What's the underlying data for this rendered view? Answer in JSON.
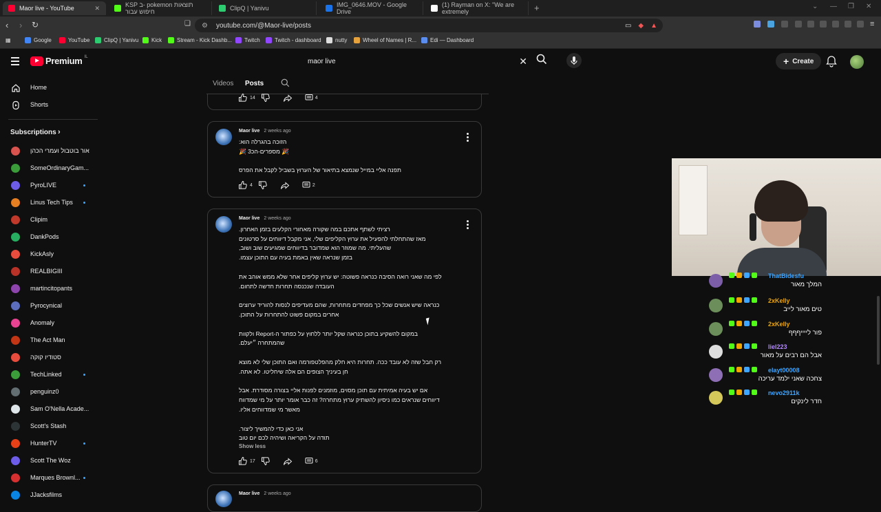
{
  "browser": {
    "tabs": [
      {
        "title": "Maor live - YouTube",
        "color": "#ff0033"
      },
      {
        "title": "KSP ב- pokemon תוצאות חיפוש עבור",
        "color": "#53fc18"
      },
      {
        "title": "ClipQ | Yanivu",
        "color": "#2ecc71"
      },
      {
        "title": "IMG_0646.MOV - Google Drive",
        "color": "#1a73e8"
      },
      {
        "title": "(1) Rayman on X: \"We are extremely",
        "color": "#ffffff"
      }
    ],
    "url": "youtube.com/@Maor-live/posts",
    "bookmarks": [
      {
        "label": "Google",
        "color": "#4285f4"
      },
      {
        "label": "YouTube",
        "color": "#ff0033"
      },
      {
        "label": "ClipQ | Yanivu",
        "color": "#2ecc71"
      },
      {
        "label": "Kick",
        "color": "#53fc18"
      },
      {
        "label": "Stream - Kick Dashb...",
        "color": "#53fc18"
      },
      {
        "label": "Twitch",
        "color": "#9146ff"
      },
      {
        "label": "Twitch - dashboard",
        "color": "#9146ff"
      },
      {
        "label": "nutty",
        "color": "#dddddd"
      },
      {
        "label": "Wheel of Names | R...",
        "color": "#e6a23c"
      },
      {
        "label": "Edi — Dashboard",
        "color": "#5b8def"
      }
    ]
  },
  "youtube": {
    "logo_text": "Premium",
    "country": "IL",
    "search_value": "maor live",
    "create_label": "Create",
    "sidebar": {
      "main": [
        {
          "label": "Home",
          "icon": "home-icon"
        },
        {
          "label": "Shorts",
          "icon": "shorts-icon"
        }
      ],
      "subscriptions_label": "Subscriptions",
      "channels": [
        {
          "label": "אור בוטבול ועמרי הכהן",
          "color": "#d9534f",
          "dot": false
        },
        {
          "label": "SomeOrdinaryGam...",
          "color": "#3a9d3a",
          "dot": false
        },
        {
          "label": "PyroLIVE",
          "color": "#6c5ce7",
          "dot": true
        },
        {
          "label": "Linus Tech Tips",
          "color": "#e67e22",
          "dot": true
        },
        {
          "label": "Clipim",
          "color": "#c0392b",
          "dot": false
        },
        {
          "label": "DankPods",
          "color": "#27ae60",
          "dot": false
        },
        {
          "label": "KickAsly",
          "color": "#e74c3c",
          "dot": false
        },
        {
          "label": "REALBIGIII",
          "color": "#b83227",
          "dot": false
        },
        {
          "label": "martincitopants",
          "color": "#8e44ad",
          "dot": false
        },
        {
          "label": "Pyrocynical",
          "color": "#5d6dbe",
          "dot": false
        },
        {
          "label": "Anomaly",
          "color": "#e84393",
          "dot": false
        },
        {
          "label": "The Act Man",
          "color": "#c23616",
          "dot": false
        },
        {
          "label": "סטודיו קוקה",
          "color": "#e74c3c",
          "dot": false
        },
        {
          "label": "TechLinked",
          "color": "#3a9d3a",
          "dot": true
        },
        {
          "label": "penguinz0",
          "color": "#636e72",
          "dot": false
        },
        {
          "label": "Sam O'Nella Acade...",
          "color": "#dfe6e9",
          "dot": false
        },
        {
          "label": "Scott's Stash",
          "color": "#2d3436",
          "dot": false
        },
        {
          "label": "HunterTV",
          "color": "#e84118",
          "dot": true
        },
        {
          "label": "Scott The Woz",
          "color": "#6c5ce7",
          "dot": false
        },
        {
          "label": "Marques Brownl...",
          "color": "#d63031",
          "dot": true
        },
        {
          "label": "JJacksfilms",
          "color": "#0984e3",
          "dot": false
        }
      ]
    },
    "channel_tabs": [
      "Videos",
      "Posts"
    ],
    "posts": [
      {
        "likes": "14",
        "comments": "4"
      },
      {
        "author": "Maor live",
        "time": "2 weeks ago",
        "lines": [
          "הזוכה בהגרלה הוא:",
          "🎉 מספרים-הכ3 🎉",
          "",
          "תפנה אליי במייל שנמצא בתיאור של הערוץ בשביל לקבל את הפרס"
        ],
        "likes": "4",
        "comments": "2"
      },
      {
        "author": "Maor live",
        "time": "2 weeks ago",
        "lines": [
          "רציתי לשתף אתכם במה שקורה מאחורי הקלעים בזמן האחרון.",
          "מאז שהתחלתי להפעיל את ערוץ הקליפים שלי, אני מקבל דיווחים על סרטונים",
          "שהעליתי. מה שמוזר הוא שמדובר בדיווחים שמגיעים שוב ושוב,",
          "בזמן שנראה שאין באמת בעיה עם התוכן עצמו.",
          "",
          "לפי מה שאני רואה הסיבה כנראה פשוטה: יש ערוץ קליפים אחר שלא ממש אוהב את",
          "העובדה שנכנסה תחרות חדשה לתחום.",
          "",
          "כנראה שיש אנשים שכל כך מפחדים מתחרות, שהם מעדיפים לנסות להוריד ערוצים",
          "אחרים במקום פשוט להתחרות על התוכן.",
          "",
          "במקום להשקיע בתוכן כנראה שקל יותר ללחוץ על כפתור ה-Report ולקוות",
          "שהמתחרה ״יעלם.",
          "",
          "רק חבל שזה לא עובד ככה. תחרות היא חלק מהפלטפורמה ואם התוכן שלי לא מוצא",
          "חן בעיניך הצופים הם אלה שיחליטו. לא אתה.",
          "",
          "אם יש בעיה אמיתית עם תוכן מסוים, מוזמנים לפנות אליי בצורה מסודרת. אבל",
          "דיווחים שנראים כמו ניסיון להשתיק ערוץ מתחרה? זה כבר אומר יותר על מי שמדווח",
          "מאשר מי שמדווחים אליו.",
          "",
          "אני כאן כדי להמשיך ליצור.",
          "תודה על הקריאה ושיהיה לכם יום טוב"
        ],
        "show_less": "Show less",
        "likes": "17",
        "comments": "6"
      },
      {
        "author": "Maor live",
        "time": "2 weeks ago"
      }
    ]
  },
  "chat": [
    {
      "name": "ThatBidesfu",
      "name_color": "#3ea6ff",
      "text": "המלך מאור",
      "avatar": "#7b5ea7"
    },
    {
      "name": "2xKelly",
      "name_color": "#f0a500",
      "text": "טים מאור לייב",
      "avatar": "#6b8e5a"
    },
    {
      "name": "2xKelly",
      "name_color": "#f0a500",
      "text": "פור לייייףףף",
      "avatar": "#6b8e5a"
    },
    {
      "name": "liel223",
      "name_color": "#b388ff",
      "text": "אבל הם רבים על מאור",
      "avatar": "#dddddd"
    },
    {
      "name": "elayt00008",
      "name_color": "#3ea6ff",
      "text": "צחכה שאני ילמד עריכה",
      "avatar": "#8e6fb5"
    },
    {
      "name": "nevo2911k",
      "name_color": "#3ea6ff",
      "text": "חדר לינקים",
      "avatar": "#d4c85a"
    }
  ]
}
